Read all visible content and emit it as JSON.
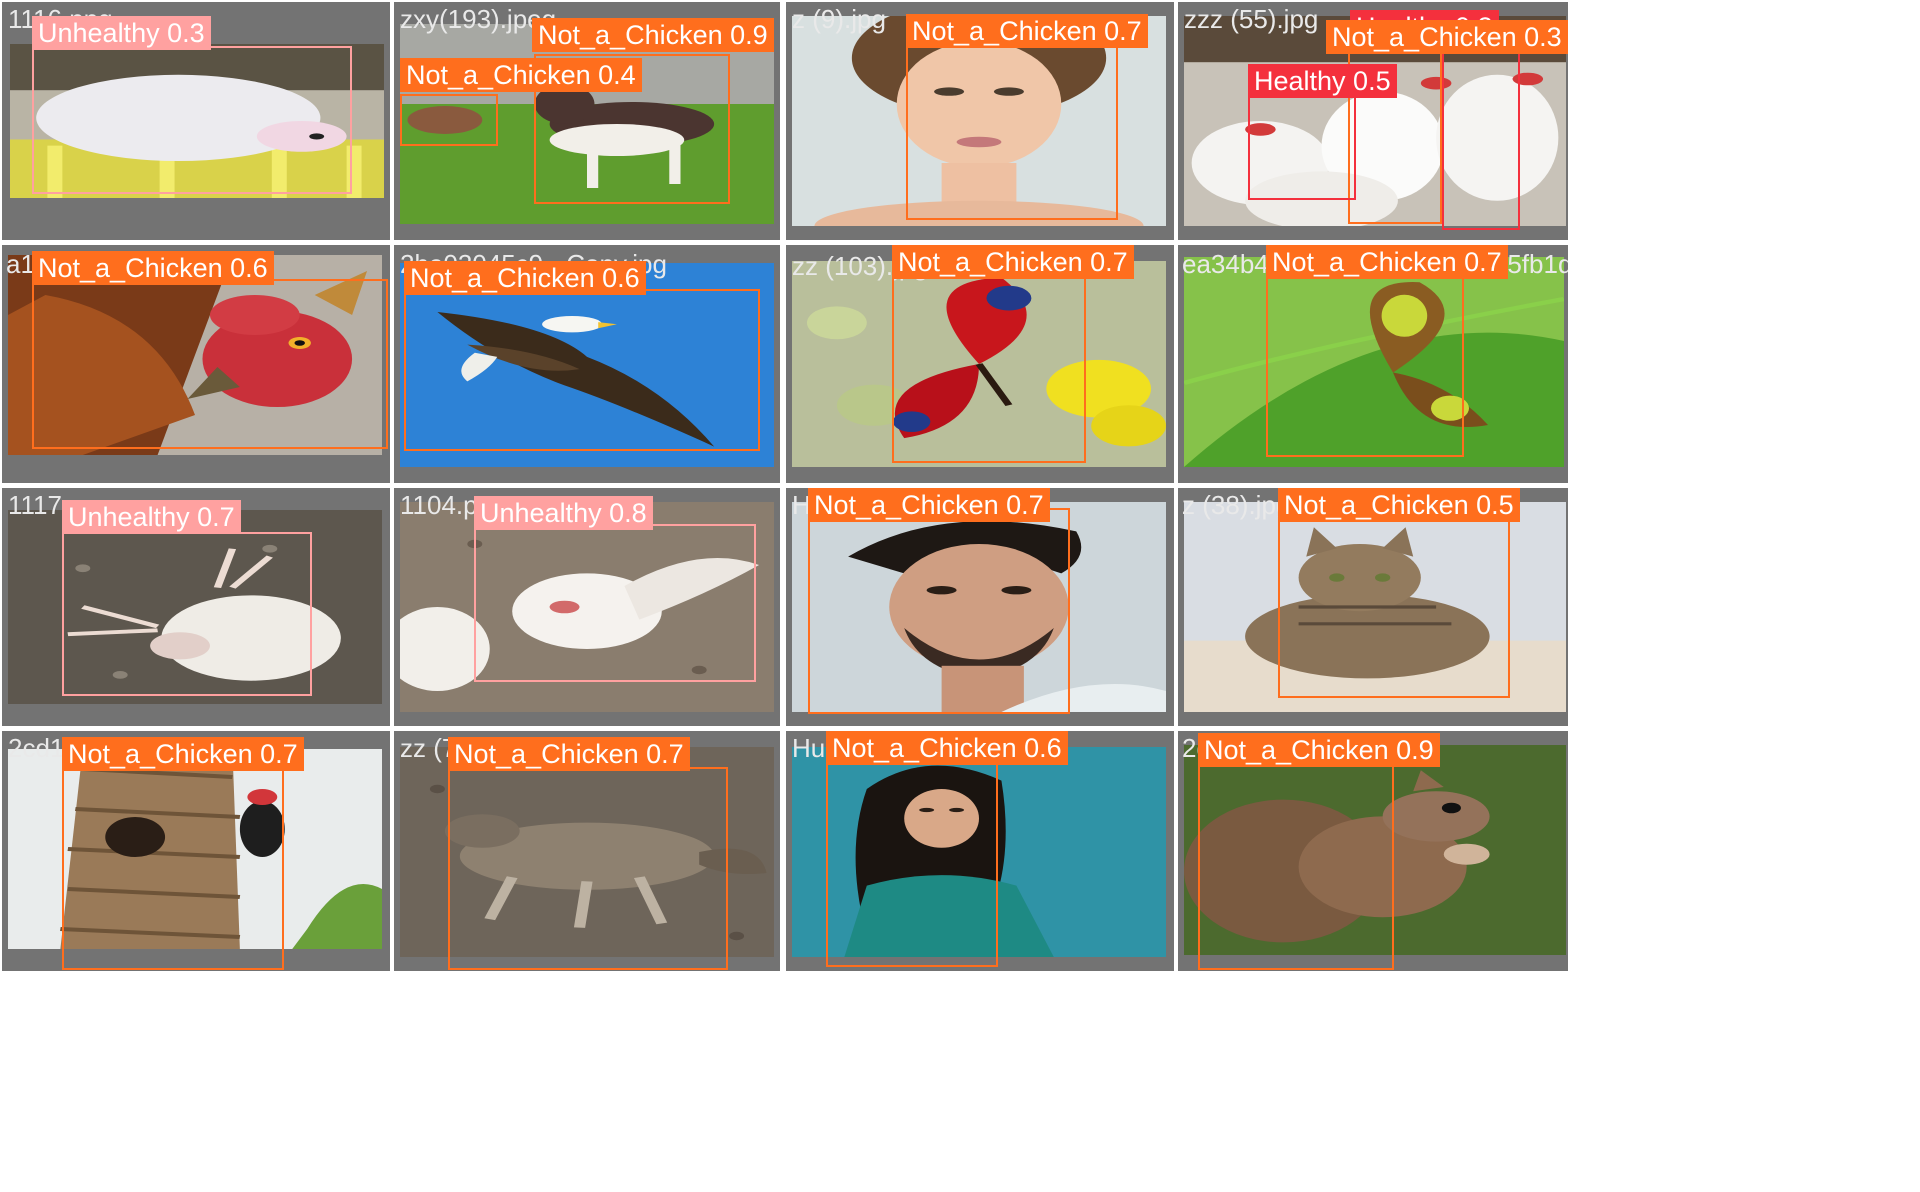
{
  "colors": {
    "Not_a_Chicken": "#ff6e1d",
    "Unhealthy": "#ffa1a0",
    "Healthy": "#f4303d",
    "tile_background": "#737373",
    "filename_text": "#e9e9e9"
  },
  "tiles": [
    {
      "filename": "1116.png",
      "scene": "white-chicken-on-yellow-crate",
      "detections": [
        {
          "label": "Unhealthy",
          "confidence": "0.3",
          "text": "Unhealthy 0.3"
        }
      ]
    },
    {
      "filename": "zxy(193).jpeg",
      "scene": "beagle-puppies-on-grass",
      "detections": [
        {
          "label": "Not_a_Chicken",
          "confidence": "0.9",
          "text": "Not_a_Chicken 0.9"
        },
        {
          "label": "Not_a_Chicken",
          "confidence": "0.4",
          "text": "Not_a_Chicken 0.4"
        }
      ]
    },
    {
      "filename": "z (9).jpg",
      "scene": "woman-portrait",
      "detections": [
        {
          "label": "Not_a_Chicken",
          "confidence": "0.7",
          "text": "Not_a_Chicken 0.7"
        }
      ]
    },
    {
      "filename": "zzz (55).jpg",
      "scene": "white-chicken-flock",
      "detections": [
        {
          "label": "Healthy",
          "confidence": "0.3",
          "text": "Healthy 0.3"
        },
        {
          "label": "Not_a_Chicken",
          "confidence": "0.3",
          "text": "Not_a_Chicken 0.3"
        },
        {
          "label": "Healthy",
          "confidence": "0.5",
          "text": "Healthy 0.5"
        }
      ]
    },
    {
      "filename": "a1",
      "scene": "rooster-head-closeup",
      "detections": [
        {
          "label": "Not_a_Chicken",
          "confidence": "0.6",
          "text": "Not_a_Chicken 0.6"
        }
      ]
    },
    {
      "filename": "2be03045c9 - Copy.jpg",
      "scene": "bald-eagle-in-flight",
      "detections": [
        {
          "label": "Not_a_Chicken",
          "confidence": "0.6",
          "text": "Not_a_Chicken 0.6"
        }
      ]
    },
    {
      "filename": "zz (103).jpg",
      "scene": "peacock-butterfly-on-flowers",
      "detections": [
        {
          "label": "Not_a_Chicken",
          "confidence": "0.7",
          "text": "Not_a_Chicken 0.7"
        }
      ]
    },
    {
      "filename": "ea34b40a21fd013ed1584d05fb1d",
      "scene": "malachite-butterfly-on-leaf",
      "detections": [
        {
          "label": "Not_a_Chicken",
          "confidence": "0.7",
          "text": "Not_a_Chicken 0.7"
        }
      ]
    },
    {
      "filename": "1117.png",
      "scene": "chicken-lying-on-ground",
      "detections": [
        {
          "label": "Unhealthy",
          "confidence": "0.7",
          "text": "Unhealthy 0.7"
        }
      ]
    },
    {
      "filename": "1104.png",
      "scene": "dead-chicken-on-litter",
      "detections": [
        {
          "label": "Unhealthy",
          "confidence": "0.8",
          "text": "Unhealthy 0.8"
        }
      ]
    },
    {
      "filename": "Humans (50).jpg",
      "scene": "man-portrait",
      "detections": [
        {
          "label": "Not_a_Chicken",
          "confidence": "0.7",
          "text": "Not_a_Chicken 0.7"
        }
      ]
    },
    {
      "filename": "z (38).jpg",
      "scene": "tabby-cat-lying",
      "detections": [
        {
          "label": "Not_a_Chicken",
          "confidence": "0.5",
          "text": "Not_a_Chicken 0.5"
        }
      ]
    },
    {
      "filename": "2cd1",
      "scene": "woodpecker-on-palm-trunk",
      "detections": [
        {
          "label": "Not_a_Chicken",
          "confidence": "0.7",
          "text": "Not_a_Chicken 0.7"
        }
      ]
    },
    {
      "filename": "zz (7",
      "scene": "coyote-lying-on-ground",
      "detections": [
        {
          "label": "Not_a_Chicken",
          "confidence": "0.7",
          "text": "Not_a_Chicken 0.7"
        }
      ]
    },
    {
      "filename": "Humans (51).jpg",
      "scene": "woman-on-teal-background",
      "detections": [
        {
          "label": "Not_a_Chicken",
          "confidence": "0.6",
          "text": "Not_a_Chicken 0.6"
        }
      ]
    },
    {
      "filename": "2d",
      "scene": "squirrel-eating",
      "detections": [
        {
          "label": "Not_a_Chicken",
          "confidence": "0.9",
          "text": "Not_a_Chicken 0.9"
        }
      ]
    }
  ]
}
